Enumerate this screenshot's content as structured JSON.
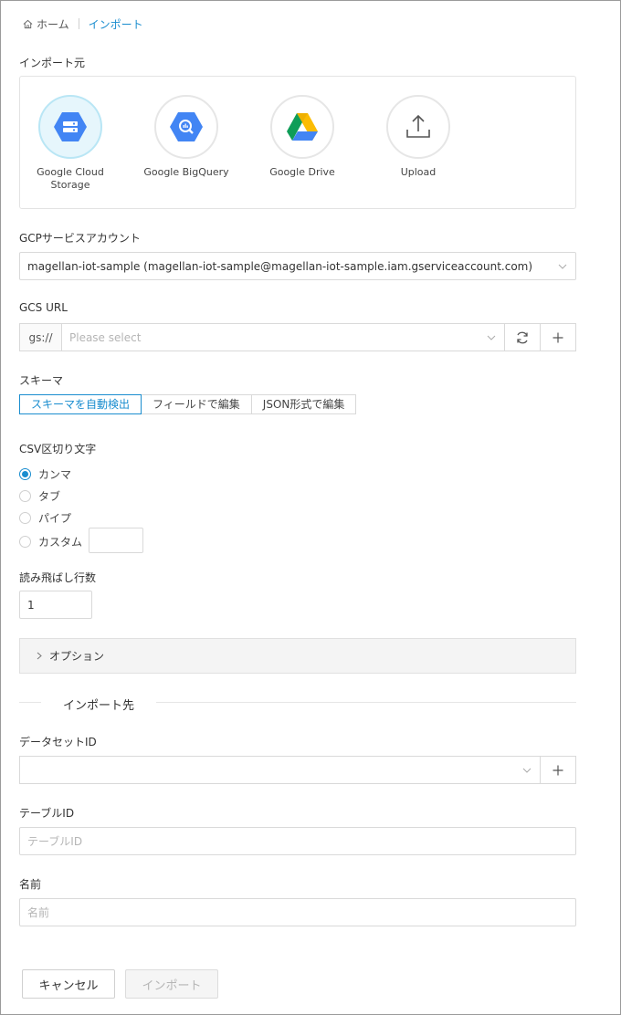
{
  "breadcrumb": {
    "home": "ホーム",
    "current": "インポート"
  },
  "source": {
    "label": "インポート元",
    "items": [
      {
        "name": "Google Cloud Storage",
        "line1": "Google Cloud",
        "line2": "Storage",
        "icon": "gcs-icon",
        "active": true
      },
      {
        "name": "Google BigQuery",
        "line1": "Google BigQuery",
        "line2": "",
        "icon": "bigquery-icon",
        "active": false
      },
      {
        "name": "Google Drive",
        "line1": "Google Drive",
        "line2": "",
        "icon": "google-drive-icon",
        "active": false
      },
      {
        "name": "Upload",
        "line1": "Upload",
        "line2": "",
        "icon": "upload-icon",
        "active": false
      }
    ]
  },
  "account": {
    "label": "GCPサービスアカウント",
    "value": "magellan-iot-sample (magellan-iot-sample@magellan-iot-sample.iam.gserviceaccount.com)"
  },
  "gcs": {
    "label": "GCS URL",
    "prefix": "gs://",
    "placeholder": "Please select"
  },
  "schema": {
    "label": "スキーマ",
    "options": [
      "スキーマを自動検出",
      "フィールドで編集",
      "JSON形式で編集"
    ],
    "selected": 0
  },
  "delimiter": {
    "label": "CSV区切り文字",
    "options": [
      "カンマ",
      "タブ",
      "パイプ",
      "カスタム"
    ],
    "selected": 0,
    "custom_value": ""
  },
  "skip_rows": {
    "label": "読み飛ばし行数",
    "value": "1"
  },
  "options_panel": {
    "label": "オプション"
  },
  "destination": {
    "section": "インポート先"
  },
  "dataset": {
    "label": "データセットID",
    "value": ""
  },
  "table": {
    "label": "テーブルID",
    "placeholder": "テーブルID"
  },
  "name": {
    "label": "名前",
    "placeholder": "名前"
  },
  "actions": {
    "cancel": "キャンセル",
    "import": "インポート"
  },
  "colors": {
    "accent": "#1a8dcf",
    "gcp_blue": "#4285f4"
  }
}
